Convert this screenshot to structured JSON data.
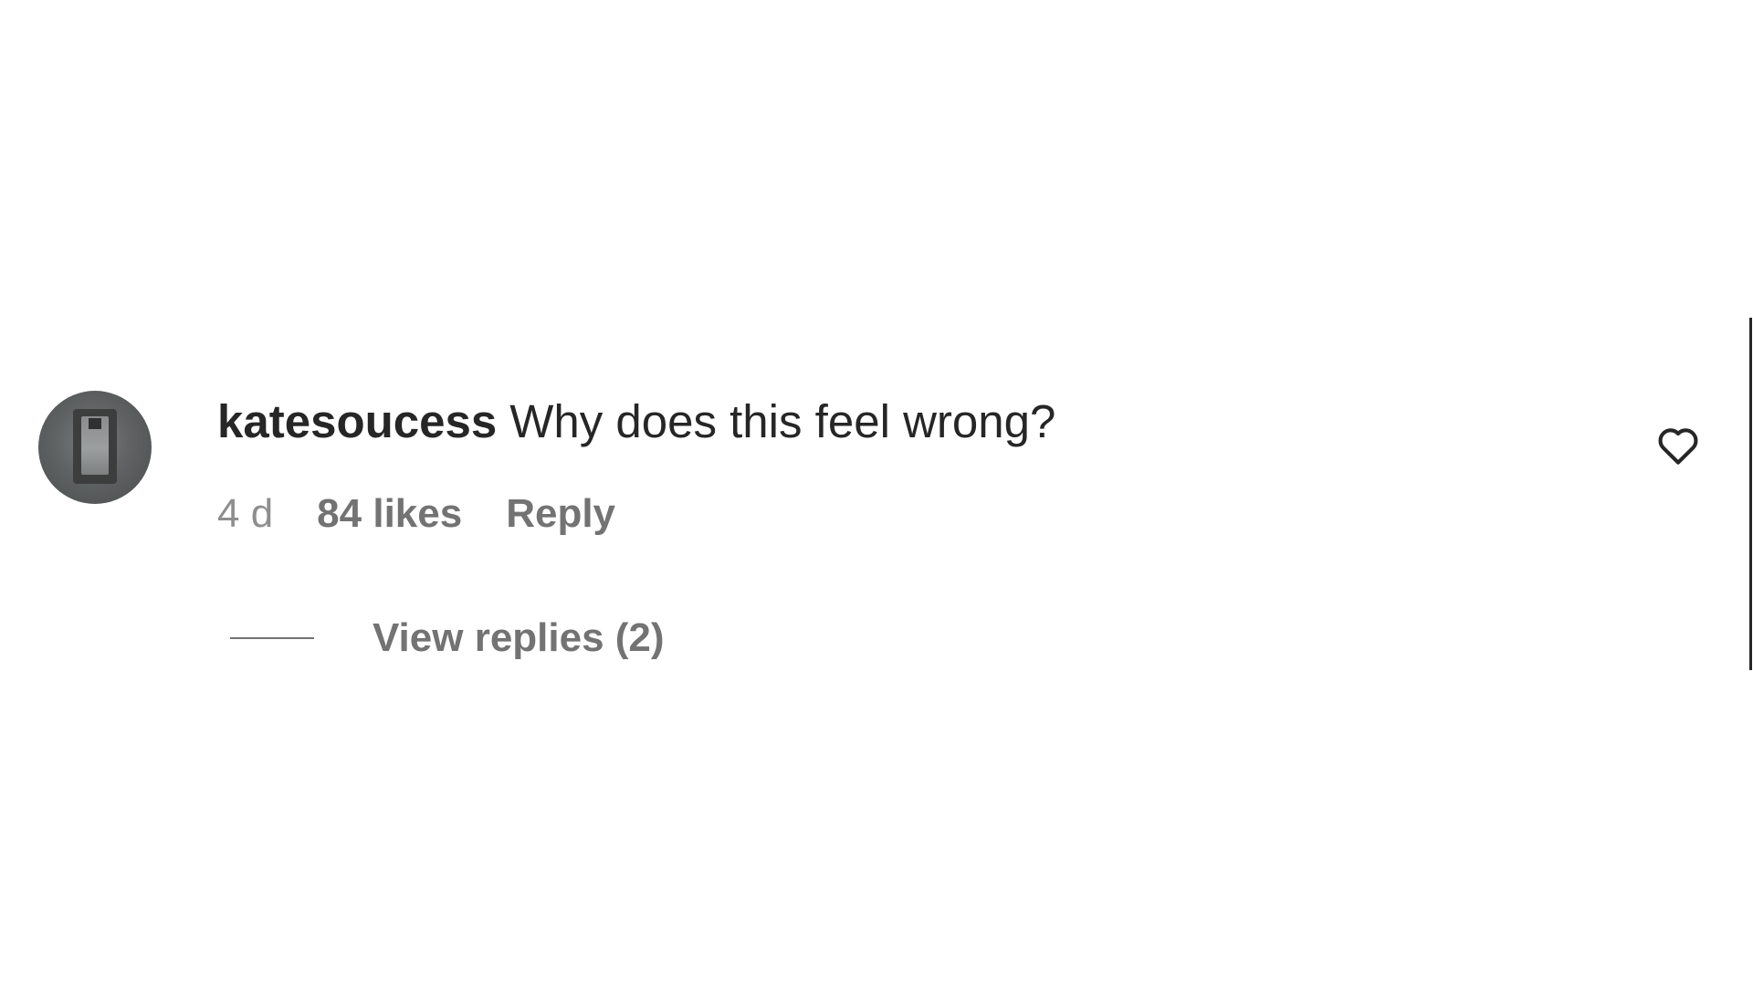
{
  "comment": {
    "username": "katesoucess",
    "text": "Why does this feel wrong?",
    "time": "4 d",
    "likes": "84 likes",
    "reply_label": "Reply",
    "view_replies_label": "View replies (2)",
    "like_icon": "heart-outline-icon"
  },
  "colors": {
    "primary_text": "#262626",
    "secondary_text": "#737373",
    "background": "#ffffff"
  }
}
